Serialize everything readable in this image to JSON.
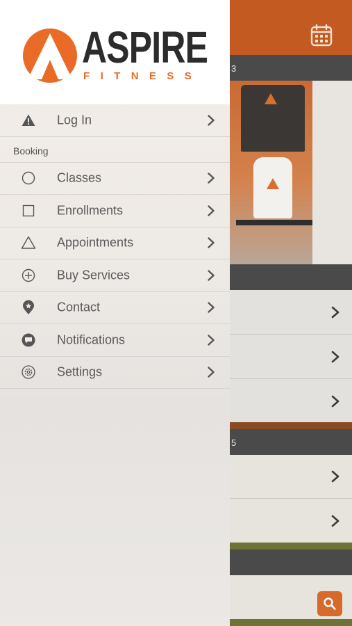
{
  "background": {
    "strip_numbers": [
      "3",
      "5"
    ],
    "header_color": "#c25a22"
  },
  "logo": {
    "title": "ASPIRE",
    "subtitle": "FITNESS",
    "accent_color": "#ea6b27"
  },
  "menu": {
    "login": {
      "label": "Log In",
      "icon": "warning-icon"
    },
    "section_label": "Booking",
    "items": [
      {
        "label": "Classes",
        "icon": "circle-icon"
      },
      {
        "label": "Enrollments",
        "icon": "square-icon"
      },
      {
        "label": "Appointments",
        "icon": "triangle-icon"
      },
      {
        "label": "Buy Services",
        "icon": "plus-circle-icon"
      },
      {
        "label": "Contact",
        "icon": "location-pin-icon"
      },
      {
        "label": "Notifications",
        "icon": "chat-bubble-icon"
      },
      {
        "label": "Settings",
        "icon": "gear-icon"
      }
    ]
  }
}
